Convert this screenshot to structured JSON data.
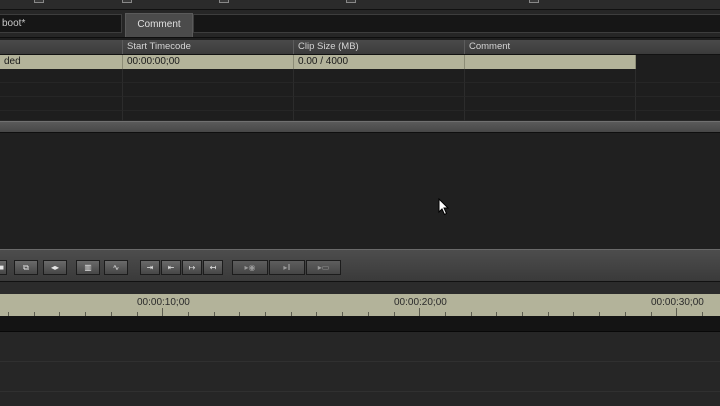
{
  "menu_fragments": [
    {
      "text": "",
      "x": 0
    },
    {
      "text": "...........",
      "x": 0
    },
    {
      "text": "",
      "x": 0
    }
  ],
  "title_field": {
    "value": "boot*"
  },
  "comment_tab": {
    "label": "Comment"
  },
  "table": {
    "columns": [
      "",
      "Start Timecode",
      "Clip Size (MB)",
      "Comment"
    ],
    "rows": [
      [
        "ded",
        "00:00:00;00",
        "0.00 / 4000",
        ""
      ]
    ]
  },
  "timeline": {
    "timecodes": [
      "00:00:10;00",
      "00:00:20;00",
      "00:00:30;00"
    ]
  },
  "colors": {
    "accent": "#b3b39a",
    "panel": "#1f1f1f"
  },
  "toolbar_icons": [
    "stop-icon",
    "copy-icon",
    "expand-icon",
    "frames-icon",
    "wave-icon",
    "mark-in-icon",
    "go-start-icon",
    "go-end-icon",
    "mark-out-icon",
    "play-icon",
    "pause-icon",
    "record-icon"
  ]
}
